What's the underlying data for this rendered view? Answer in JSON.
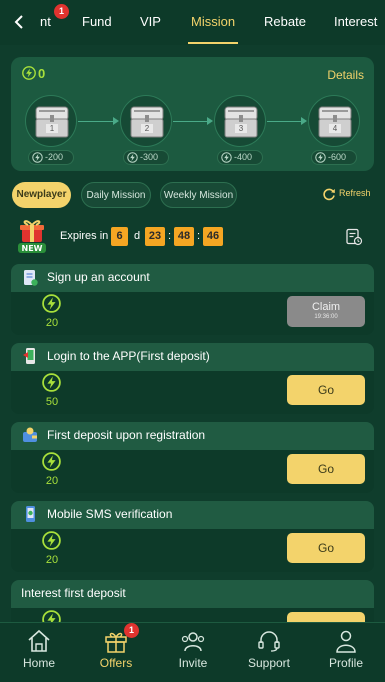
{
  "nav": {
    "tabs": [
      {
        "label": "nt",
        "badge": "1"
      },
      {
        "label": "Fund"
      },
      {
        "label": "VIP"
      },
      {
        "label": "Mission",
        "active": true
      },
      {
        "label": "Rebate"
      },
      {
        "label": "Interest"
      }
    ]
  },
  "chest_card": {
    "points": "0",
    "details_label": "Details",
    "chests": [
      {
        "number": "1",
        "cost": "-200"
      },
      {
        "number": "2",
        "cost": "-300"
      },
      {
        "number": "3",
        "cost": "-400"
      },
      {
        "number": "4",
        "cost": "-600"
      }
    ]
  },
  "segments": {
    "items": [
      "Newplayer",
      "Daily Mission",
      "Weekly Mission"
    ],
    "active": "Newplayer",
    "refresh_label": "Refresh"
  },
  "expiry": {
    "label": "Expires in",
    "days": "6",
    "days_unit": "d",
    "hours": "23",
    "minutes": "48",
    "seconds": "46",
    "separator": ":"
  },
  "new_badge": "NEW",
  "tasks": [
    {
      "title": "Sign up an account",
      "reward": "20",
      "action": "Claim",
      "action_sub": "19:36:00"
    },
    {
      "title": "Login to the APP(First deposit)",
      "reward": "50",
      "action": "Go"
    },
    {
      "title": "First deposit upon registration",
      "reward": "20",
      "action": "Go"
    },
    {
      "title": "Mobile SMS verification",
      "reward": "20",
      "action": "Go"
    },
    {
      "title": "Interest first deposit"
    }
  ],
  "bottom_nav": [
    {
      "label": "Home",
      "icon": "home-icon"
    },
    {
      "label": "Offers",
      "icon": "gift-icon",
      "badge": "1",
      "active": true
    },
    {
      "label": "Invite",
      "icon": "invite-icon"
    },
    {
      "label": "Support",
      "icon": "headset-icon"
    },
    {
      "label": "Profile",
      "icon": "profile-icon"
    }
  ],
  "colors": {
    "background": "#0f3d2c",
    "card": "#1c5a40",
    "accent_gold": "#f3d36b",
    "accent_green": "#a8e03b",
    "timer_orange": "#f5a623",
    "badge_red": "#e0332f"
  }
}
